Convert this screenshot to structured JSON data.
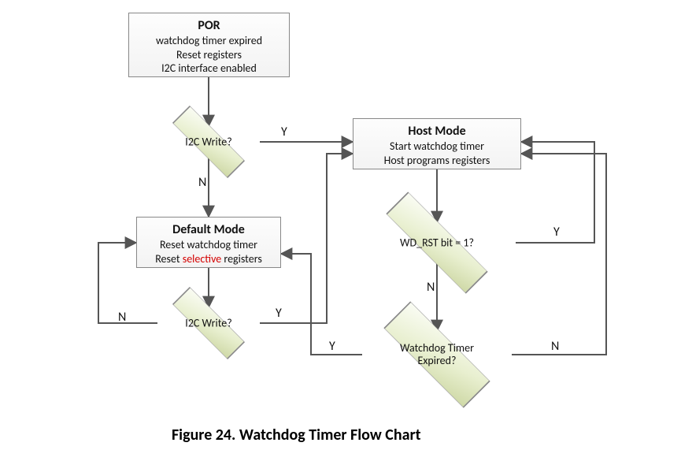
{
  "chart_data": {
    "type": "flowchart",
    "caption": "Figure 24.  Watchdog Timer Flow Chart",
    "nodes": {
      "por": {
        "kind": "process",
        "title": "POR",
        "lines": [
          "watchdog timer expired",
          "Reset registers",
          "I2C interface enabled"
        ]
      },
      "i2c_write_top": {
        "kind": "decision",
        "text": "I2C Write?"
      },
      "default_mode": {
        "kind": "process",
        "title": "Default Mode",
        "lines_pre": "Reset watchdog timer",
        "lines_reset_prefix": "Reset ",
        "lines_reset_highlight": "selective",
        "lines_reset_suffix": " registers"
      },
      "i2c_write_bottom": {
        "kind": "decision",
        "text": "I2C Write?"
      },
      "host_mode": {
        "kind": "process",
        "title": "Host Mode",
        "lines": [
          "Start watchdog timer",
          "Host programs registers"
        ]
      },
      "wd_rst": {
        "kind": "decision",
        "text": "WD_RST bit = 1?"
      },
      "wd_expired": {
        "kind": "decision",
        "text": "Watchdog Timer\nExpired?"
      }
    },
    "edges": [
      {
        "from": "por",
        "to": "i2c_write_top",
        "label": null
      },
      {
        "from": "i2c_write_top",
        "to": "host_mode",
        "label": "Y"
      },
      {
        "from": "i2c_write_top",
        "to": "default_mode",
        "label": "N"
      },
      {
        "from": "default_mode",
        "to": "i2c_write_bottom",
        "label": null
      },
      {
        "from": "i2c_write_bottom",
        "to": "default_mode",
        "label": "N"
      },
      {
        "from": "i2c_write_bottom",
        "to": "host_mode",
        "label": "Y"
      },
      {
        "from": "host_mode",
        "to": "wd_rst",
        "label": null
      },
      {
        "from": "wd_rst",
        "to": "host_mode",
        "label": "Y"
      },
      {
        "from": "wd_rst",
        "to": "wd_expired",
        "label": "N"
      },
      {
        "from": "wd_expired",
        "to": "default_mode",
        "label": "Y"
      },
      {
        "from": "wd_expired",
        "to": "host_mode",
        "label": "N"
      }
    ],
    "edge_labels": {
      "yes": "Y",
      "no": "N"
    }
  }
}
